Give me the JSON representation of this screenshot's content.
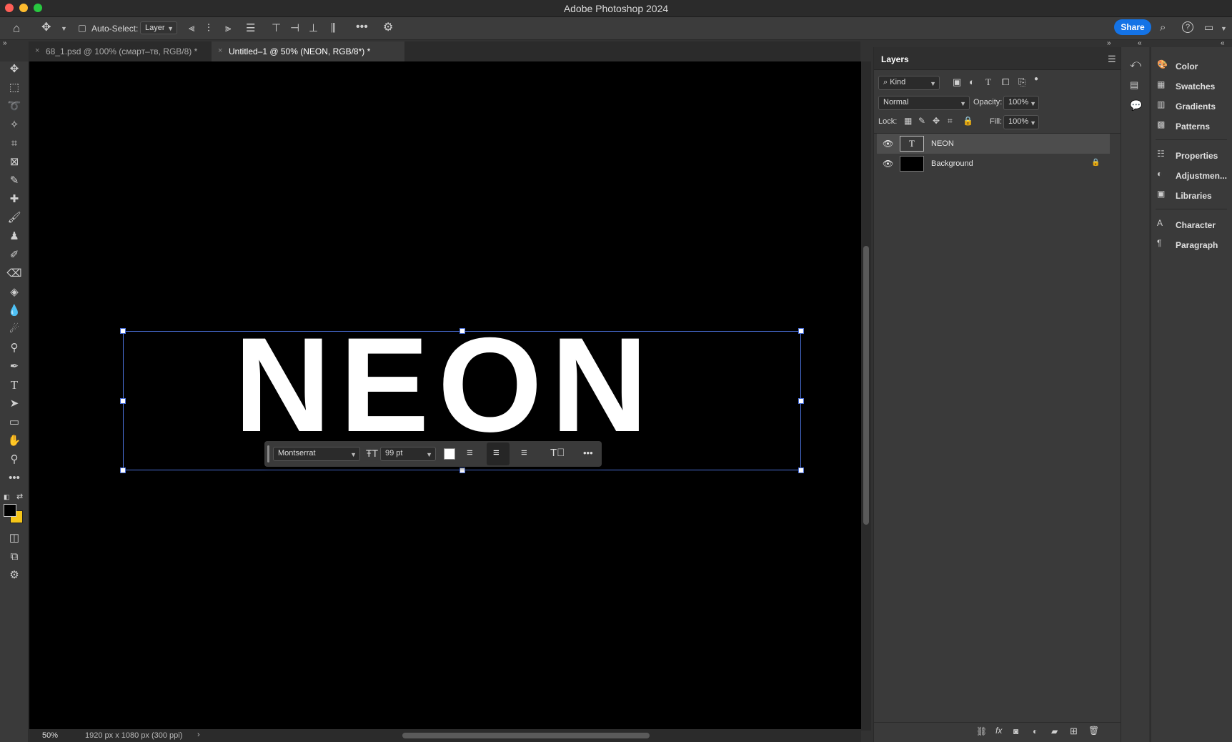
{
  "app": {
    "title": "Adobe Photoshop 2024"
  },
  "options_bar": {
    "auto_select_label": "Auto-Select:",
    "auto_select_target": "Layer",
    "share_label": "Share"
  },
  "tabs": [
    {
      "label": "68_1.psd @ 100% (смарт–тв, RGB/8) *",
      "active": false
    },
    {
      "label": "Untitled–1 @ 50% (NEON, RGB/8*) *",
      "active": true
    }
  ],
  "canvas": {
    "text": "NEON",
    "background": "#000000",
    "text_color": "#ffffff"
  },
  "context_bar": {
    "font_family": "Montserrat",
    "font_size": "99 pt",
    "color_swatch": "#ffffff"
  },
  "status": {
    "zoom": "50%",
    "doc_info": "1920 px x 1080 px (300 ppi)"
  },
  "layers_panel": {
    "title": "Layers",
    "filter_kind": "Kind",
    "blend_mode": "Normal",
    "opacity_label": "Opacity:",
    "opacity_value": "100%",
    "lock_label": "Lock:",
    "fill_label": "Fill:",
    "fill_value": "100%",
    "layers": [
      {
        "name": "NEON",
        "type": "text",
        "selected": true,
        "visible": true
      },
      {
        "name": "Background",
        "type": "pixel",
        "selected": false,
        "visible": true,
        "locked": true
      }
    ]
  },
  "right_panels": {
    "group1": [
      "Color",
      "Swatches",
      "Gradients",
      "Patterns"
    ],
    "group2": [
      "Properties",
      "Adjustmen...",
      "Libraries"
    ],
    "group3": [
      "Character",
      "Paragraph"
    ]
  },
  "colors": {
    "accent": "#1473e6",
    "selection": "#4a6fd8",
    "panel": "#3a3a3a",
    "foreground_swatch": "#000000",
    "background_swatch": "#f5c518"
  }
}
